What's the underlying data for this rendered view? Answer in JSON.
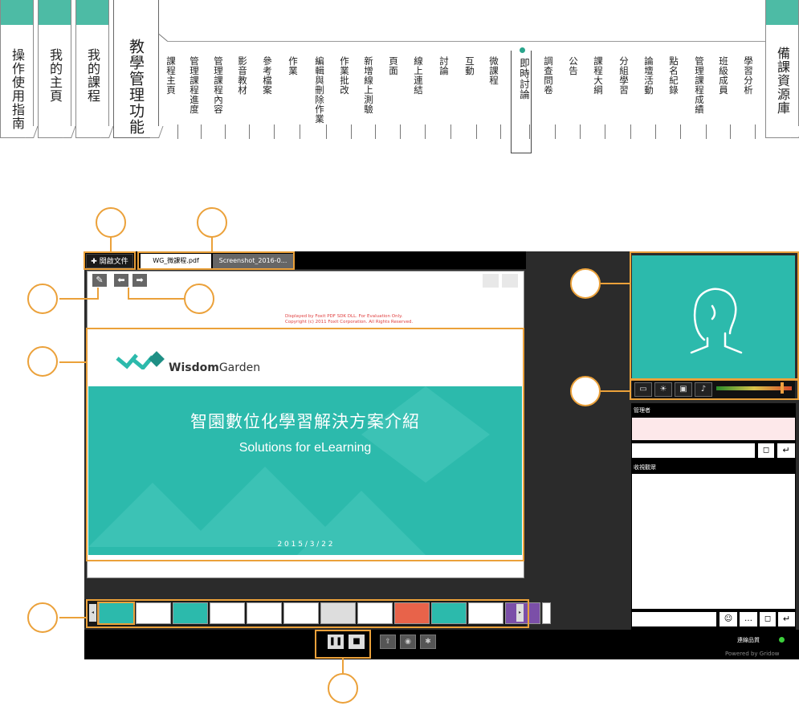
{
  "nav": {
    "major_tabs": [
      {
        "label": "操作使用指南"
      },
      {
        "label": "我的主頁"
      },
      {
        "label": "我的課程"
      },
      {
        "label": "教學管理功能"
      },
      {
        "label": "備課資源庫"
      }
    ],
    "sub_items": [
      "課程主頁",
      "管理課程進度",
      "管理課程內容",
      "影音教材",
      "參考檔案",
      "作業",
      "編輯與刪除作業",
      "作業批改",
      "新增線上測驗",
      "頁面",
      "線上連結",
      "討論",
      "互動",
      "微課程",
      "即時討論",
      "調查問卷",
      "公告",
      "課程大綱",
      "分組學習",
      "論壇活動",
      "點名紀錄",
      "管理課程成績",
      "班級成員",
      "學習分析"
    ],
    "active_sub": "即時討論"
  },
  "app": {
    "open_doc_label": "✚ 開啟文件",
    "doc_tabs": [
      {
        "label": "WG_微課程.pdf",
        "active": true
      },
      {
        "label": "Screenshot_2016-0...",
        "active": false
      }
    ],
    "watermark": [
      "Displayed by Foxit PDF SDK DLL. For Evaluation Only.",
      "Copyright (c) 2011 Foxit Corporation. All Rights Reserved."
    ],
    "slide": {
      "logo_text_bold": "Wisdom",
      "logo_text_light": "Garden",
      "title": "智園數位化學習解決方案介紹",
      "subtitle": "Solutions for eLearning",
      "date": "2 0 1 5 / 3 / 2 2"
    },
    "thumbnail_colors": [
      "#2cbaac",
      "#ffffff",
      "#2cbaac",
      "#ffffff",
      "#ffffff",
      "#ffffff",
      "#dddddd",
      "#ffffff",
      "#e8634a",
      "#2cbaac",
      "#ffffff",
      "#7b4fa8",
      "#ffffff"
    ],
    "manager_label": "管理者",
    "viewer_label": "收視觀眾",
    "connection_label": "連線品質",
    "powered_by": "Powered by Gridow"
  },
  "colors": {
    "accent": "#eba13a",
    "teal": "#2cbaac",
    "nav_green": "#4dbba5"
  }
}
